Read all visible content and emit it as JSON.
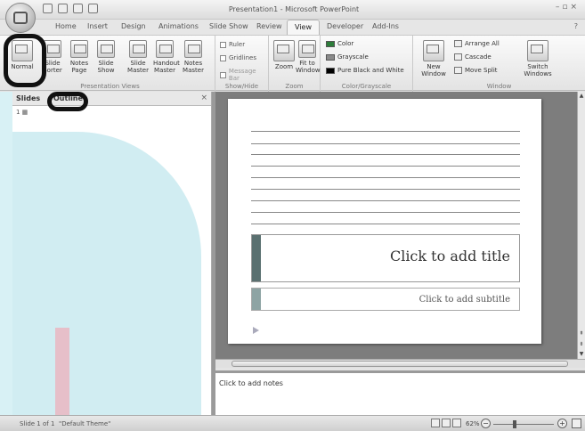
{
  "window": {
    "title": "Presentation1 - Microsoft PowerPoint"
  },
  "tabs": [
    "Home",
    "Insert",
    "Design",
    "Animations",
    "Slide Show",
    "Review",
    "View",
    "Developer",
    "Add-Ins"
  ],
  "active_tab": "View",
  "ribbon": {
    "presentation_views": {
      "label": "Presentation Views",
      "buttons": [
        {
          "label": "Normal"
        },
        {
          "label": "Slide Sorter"
        },
        {
          "label": "Notes Page"
        },
        {
          "label": "Slide Show"
        },
        {
          "label": "Slide Master"
        },
        {
          "label": "Handout Master"
        },
        {
          "label": "Notes Master"
        }
      ]
    },
    "show_hide": {
      "label": "Show/Hide",
      "items": [
        "Ruler",
        "Gridlines",
        "Message Bar"
      ]
    },
    "zoom": {
      "label": "Zoom",
      "buttons": [
        "Zoom",
        "Fit to Window"
      ]
    },
    "color_grayscale": {
      "label": "Color/Grayscale",
      "items": [
        {
          "label": "Color",
          "color": "#2d7d3a"
        },
        {
          "label": "Grayscale",
          "color": "#8a8a8a"
        },
        {
          "label": "Pure Black and White",
          "color": "#000000"
        }
      ]
    },
    "window": {
      "label": "Window",
      "new_window": "New Window",
      "items": [
        "Arrange All",
        "Cascade",
        "Move Split"
      ],
      "switch_windows": "Switch Windows"
    }
  },
  "left_panel": {
    "tabs": [
      "Slides",
      "Outline"
    ],
    "close": "×"
  },
  "slide": {
    "title_placeholder": "Click to add title",
    "subtitle_placeholder": "Click to add subtitle"
  },
  "notes": {
    "placeholder": "Click to add notes"
  },
  "status_bar": {
    "slide_count": "Slide 1 of 1",
    "theme": "\"Default Theme\"",
    "zoom": "62%"
  }
}
